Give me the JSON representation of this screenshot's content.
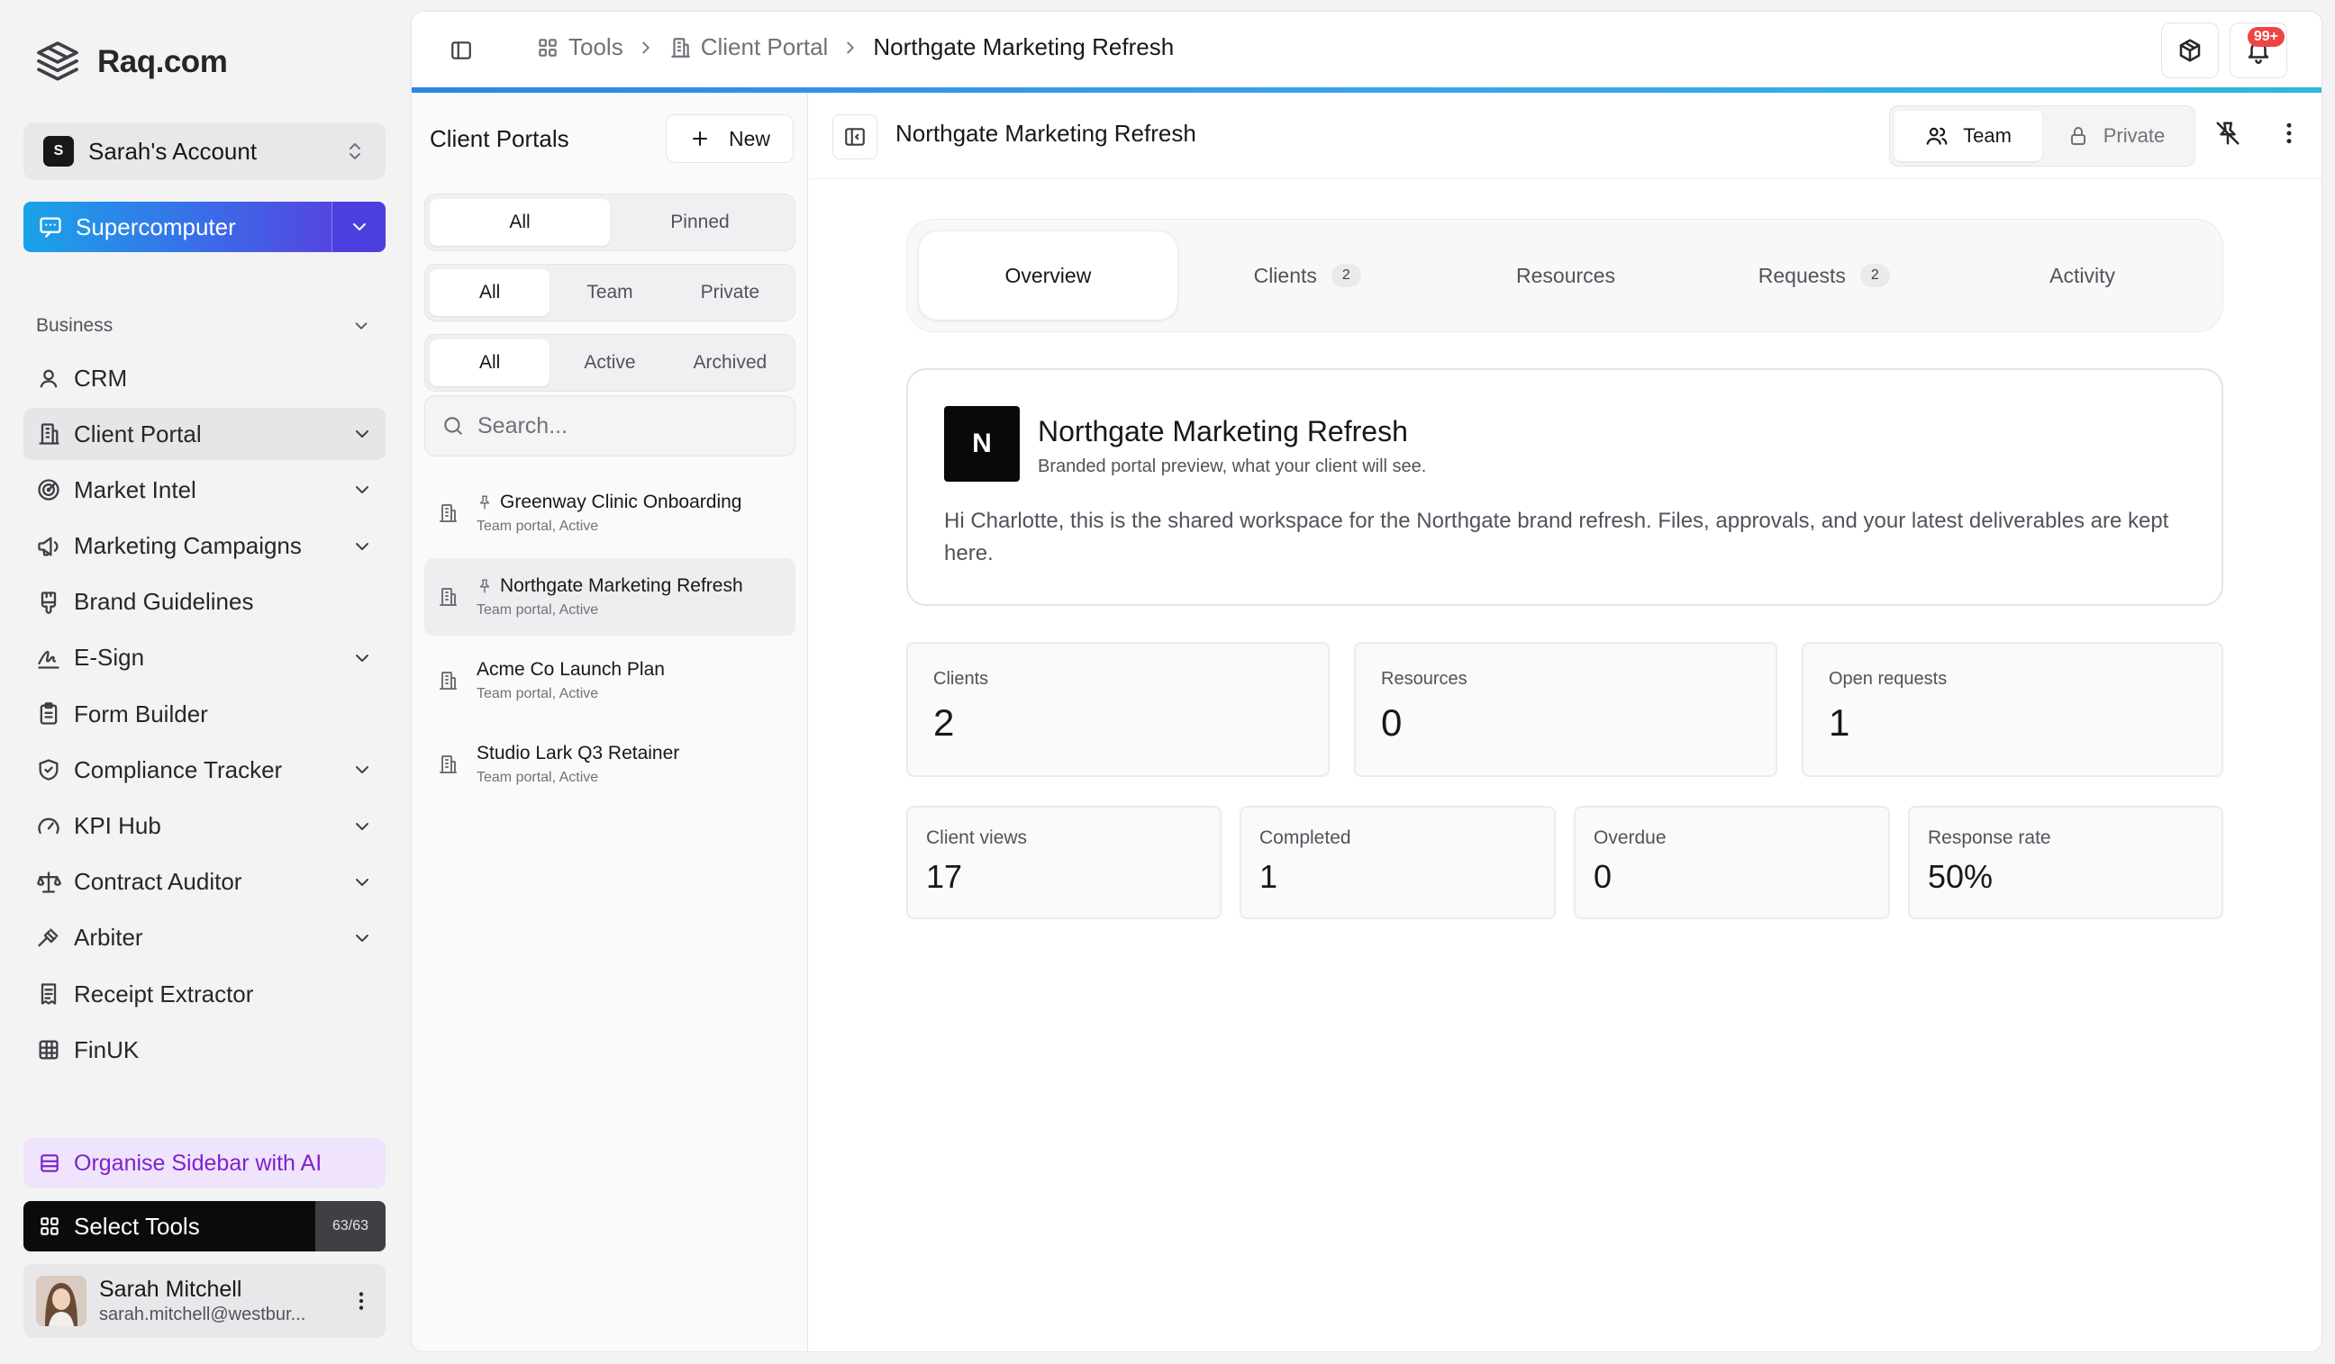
{
  "brand": {
    "name": "Raq.com"
  },
  "account": {
    "badge": "S",
    "name": "Sarah's Account"
  },
  "supercomputer": {
    "label": "Supercomputer"
  },
  "sidebar": {
    "section": "Business",
    "items": [
      {
        "label": "CRM",
        "icon": "user-icon"
      },
      {
        "label": "Client Portal",
        "icon": "building-icon"
      },
      {
        "label": "Market Intel",
        "icon": "radar-icon"
      },
      {
        "label": "Marketing Campaigns",
        "icon": "megaphone-icon"
      },
      {
        "label": "Brand Guidelines",
        "icon": "brush-icon"
      },
      {
        "label": "E-Sign",
        "icon": "signature-icon"
      },
      {
        "label": "Form Builder",
        "icon": "clipboard-icon"
      },
      {
        "label": "Compliance Tracker",
        "icon": "shield-check-icon"
      },
      {
        "label": "KPI Hub",
        "icon": "gauge-icon"
      },
      {
        "label": "Contract Auditor",
        "icon": "scale-icon"
      },
      {
        "label": "Arbiter",
        "icon": "gavel-icon"
      },
      {
        "label": "Receipt Extractor",
        "icon": "receipt-icon"
      },
      {
        "label": "FinUK",
        "icon": "grid-table-icon"
      }
    ],
    "organise_label": "Organise Sidebar with AI",
    "select_tools_label": "Select Tools",
    "select_tools_count": "63/63"
  },
  "user": {
    "name": "Sarah Mitchell",
    "email": "sarah.mitchell@westbur..."
  },
  "breadcrumb": {
    "tools": "Tools",
    "client_portal": "Client Portal",
    "current": "Northgate Marketing Refresh"
  },
  "notifications": {
    "badge": "99+"
  },
  "list": {
    "title": "Client Portals",
    "new_label": "New",
    "filter_pin": [
      "All",
      "Pinned"
    ],
    "filter_visibility": [
      "All",
      "Team",
      "Private"
    ],
    "filter_status": [
      "All",
      "Active",
      "Archived"
    ],
    "search_placeholder": "Search...",
    "portals": [
      {
        "title": "Greenway Clinic Onboarding",
        "sub": "Team portal, Active"
      },
      {
        "title": "Northgate Marketing Refresh",
        "sub": "Team portal, Active"
      },
      {
        "title": "Acme Co Launch Plan",
        "sub": "Team portal, Active"
      },
      {
        "title": "Studio Lark Q3 Retainer",
        "sub": "Team portal, Active"
      }
    ]
  },
  "detail": {
    "title": "Northgate Marketing Refresh",
    "visibility": {
      "team": "Team",
      "private": "Private"
    },
    "tabs": [
      {
        "label": "Overview",
        "count": ""
      },
      {
        "label": "Clients",
        "count": "2"
      },
      {
        "label": "Resources",
        "count": ""
      },
      {
        "label": "Requests",
        "count": "2"
      },
      {
        "label": "Activity",
        "count": ""
      }
    ],
    "hero": {
      "logo": "N",
      "title": "Northgate Marketing Refresh",
      "subtitle": "Branded portal preview, what your client will see.",
      "message": "Hi Charlotte, this is the shared workspace for the Northgate brand refresh. Files, approvals, and your latest deliverables are kept here."
    },
    "stats": [
      {
        "label": "Clients",
        "value": "2"
      },
      {
        "label": "Resources",
        "value": "0"
      },
      {
        "label": "Open requests",
        "value": "1"
      }
    ],
    "metrics": [
      {
        "label": "Client views",
        "value": "17"
      },
      {
        "label": "Completed",
        "value": "1"
      },
      {
        "label": "Overdue",
        "value": "0"
      },
      {
        "label": "Response rate",
        "value": "50%"
      }
    ]
  },
  "colors": {
    "accent_blue": "#19a4e8",
    "accent_indigo": "#4b3fe0",
    "ai_purple": "#7e22ce",
    "badge_red": "#ef4444"
  }
}
